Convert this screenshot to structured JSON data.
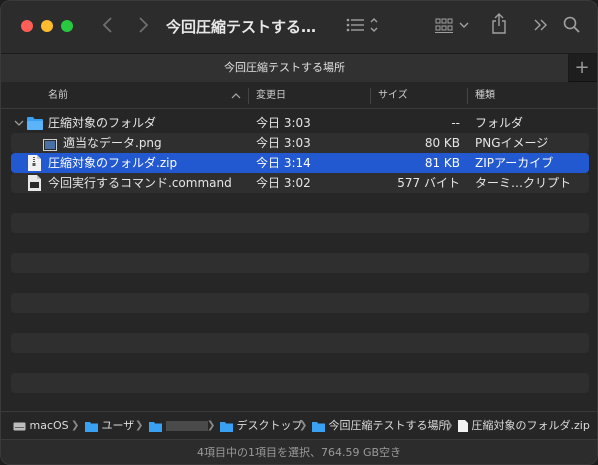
{
  "window": {
    "title": "今回圧縮テストする…",
    "tab_title": "今回圧縮テストする場所",
    "tab_add": "+"
  },
  "columns": {
    "name": "名前",
    "modified": "変更日",
    "size": "サイズ",
    "kind": "種類"
  },
  "files": [
    {
      "name": "圧縮対象のフォルダ",
      "modified": "今日 3:03",
      "size": "--",
      "kind": "フォルダ",
      "icon": "folder-icon"
    },
    {
      "name": "適当なデータ.png",
      "modified": "今日 3:03",
      "size": "80 KB",
      "kind": "PNGイメージ",
      "icon": "image-file-icon"
    },
    {
      "name": "圧縮対象のフォルダ.zip",
      "modified": "今日 3:14",
      "size": "81 KB",
      "kind": "ZIPアーカイブ",
      "icon": "zip-file-icon"
    },
    {
      "name": "今回実行するコマンド.command",
      "modified": "今日 3:02",
      "size": "577 バイト",
      "kind": "ターミ…クリプト",
      "icon": "script-file-icon"
    }
  ],
  "path": {
    "disk": "macOS",
    "users": "ユーザ",
    "user": "",
    "desktop": "デスクトップ",
    "folder": "今回圧縮テストする場所",
    "file": "圧縮対象のフォルダ.zip"
  },
  "status": "4項目中の1項目を選択、764.59 GB空き",
  "colors": {
    "selection": "#2258d0",
    "folder": "#3aa0f2"
  }
}
